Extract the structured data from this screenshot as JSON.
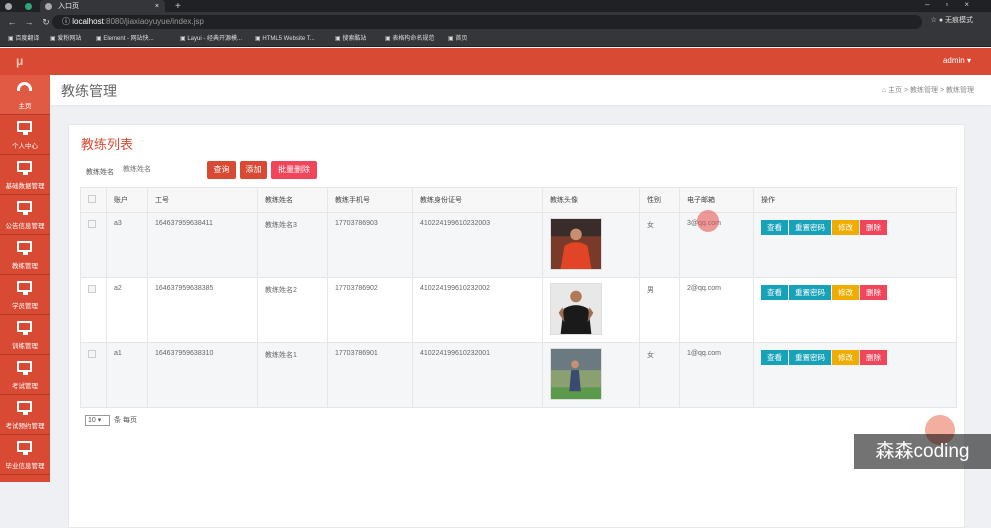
{
  "browser": {
    "tab_title": "入口页",
    "url_host": "localhost",
    "url_path": ":8080/jiaxiaoyuyue/index.jsp",
    "profile": "无痕模式",
    "bookmarks": [
      "百度翻译",
      "爱粉网站",
      "Element - 网站快...",
      "Layui - 经典开源模...",
      "HTML5 Website T...",
      "搜索酷站",
      "表格构命名规范",
      "首页"
    ]
  },
  "app": {
    "logo": "μ",
    "user": "admin ▾"
  },
  "sidebar": [
    {
      "label": "主页",
      "icon": "dashboard-icon"
    },
    {
      "label": "个人中心",
      "icon": "monitor-icon"
    },
    {
      "label": "基础数据管理",
      "icon": "monitor-icon"
    },
    {
      "label": "公告信息管理",
      "icon": "monitor-icon"
    },
    {
      "label": "教练管理",
      "icon": "monitor-icon"
    },
    {
      "label": "学员管理",
      "icon": "monitor-icon"
    },
    {
      "label": "训练管理",
      "icon": "monitor-icon"
    },
    {
      "label": "考试管理",
      "icon": "monitor-icon"
    },
    {
      "label": "考试预约管理",
      "icon": "monitor-icon"
    },
    {
      "label": "毕业信息管理",
      "icon": "monitor-icon"
    }
  ],
  "page": {
    "title": "教练管理",
    "breadcrumb": "⌂ 主页  >  教练管理  >  教练管理",
    "card_title": "教练列表",
    "search_label": "教练姓名",
    "search_placeholder": "教练姓名",
    "buttons": {
      "search": "查询",
      "add": "添加",
      "batch_delete": "批量删除"
    },
    "actions": {
      "view": "查看",
      "reset": "重置密码",
      "edit": "修改",
      "delete": "删除"
    },
    "columns": [
      "账户",
      "工号",
      "教练姓名",
      "教练手机号",
      "教练身份证号",
      "教练头像",
      "性别",
      "电子邮箱",
      "操作"
    ],
    "rows": [
      {
        "account": "a3",
        "job_no": "164637959638411",
        "name": "教练姓名3",
        "phone": "17703786903",
        "id_card": "410224199610232003",
        "gender": "女",
        "email": "3@qq.com"
      },
      {
        "account": "a2",
        "job_no": "164637959638385",
        "name": "教练姓名2",
        "phone": "17703786902",
        "id_card": "410224199610232002",
        "gender": "男",
        "email": "2@qq.com"
      },
      {
        "account": "a1",
        "job_no": "164637959638310",
        "name": "教练姓名1",
        "phone": "17703786901",
        "id_card": "410224199610232001",
        "gender": "女",
        "email": "1@qq.com"
      }
    ],
    "page_size": "10",
    "page_size_suffix": "条 每页"
  },
  "watermark": "森森coding",
  "colors": {
    "brand": "#d84a34",
    "view": "#17a2b8",
    "edit": "#f0ad00",
    "delete": "#f0455a"
  }
}
